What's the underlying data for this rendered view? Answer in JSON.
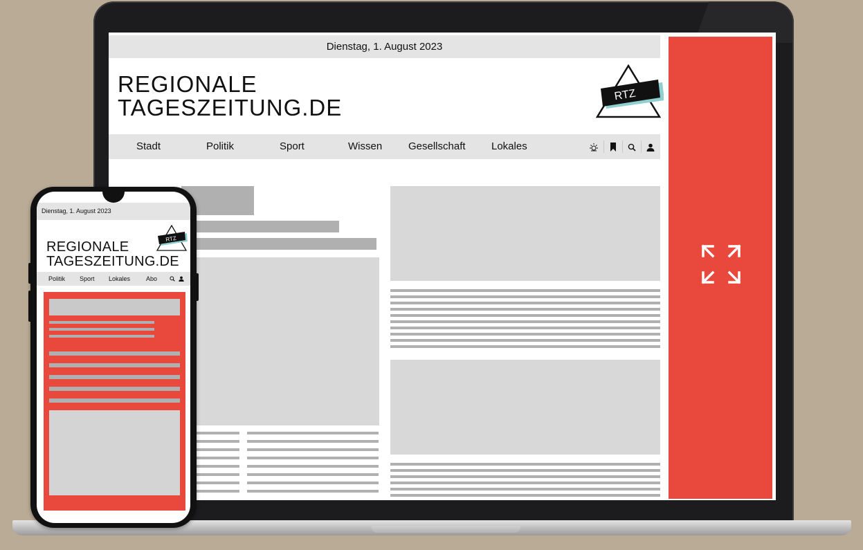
{
  "desktop": {
    "date": "Dienstag, 1. August 2023",
    "site_title": "REGIONALE\nTAGESZEITUNG.DE",
    "logo_text": "RTZ",
    "nav_items": [
      "Stadt",
      "Politik",
      "Sport",
      "Wissen",
      "Gesellschaft",
      "Lokales"
    ],
    "nav_icons": [
      "weather-icon",
      "bookmark-icon",
      "search-icon",
      "user-icon"
    ]
  },
  "mobile": {
    "date": "Dienstag, 1. August 2023",
    "site_title": "REGIONALE\nTAGESZEITUNG.DE",
    "logo_text": "RTZ",
    "nav_items": [
      "Politik",
      "Sport",
      "Lokales",
      "Abo"
    ],
    "nav_icons": [
      "search-icon",
      "user-icon"
    ]
  },
  "colors": {
    "background": "#b9ab95",
    "accent_red": "#e9493d",
    "placeholder_gray": "#d8d8d8",
    "placeholder_line": "#b0b0b0",
    "bar_gray": "#e4e4e4",
    "logo_teal": "#8fcfcf"
  },
  "icons": {
    "ad_panel": "expand-arrows-icon"
  }
}
